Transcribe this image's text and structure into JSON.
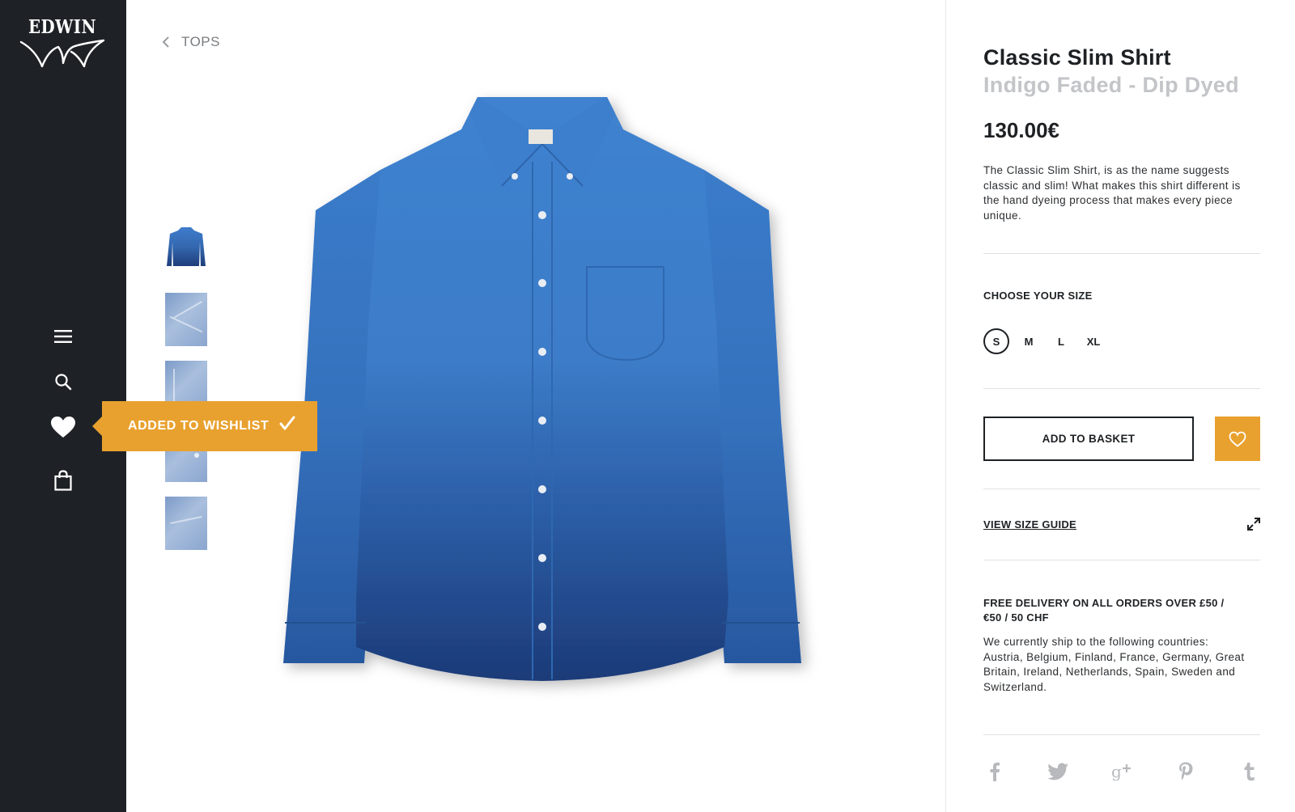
{
  "brand": {
    "name": "EDWIN"
  },
  "sidebar": {
    "icons": [
      "menu-icon",
      "search-icon",
      "heart-icon",
      "bag-icon"
    ]
  },
  "breadcrumb": {
    "label": "TOPS"
  },
  "toast": {
    "message": "ADDED TO WISHLIST"
  },
  "product": {
    "title": "Classic Slim Shirt",
    "subtitle": "Indigo Faded - Dip Dyed",
    "price": "130.00€",
    "description": "The Classic Slim Shirt, is as the name suggests classic and slim! What makes this shirt different is the hand dyeing process that makes every piece unique."
  },
  "size_selector": {
    "label": "CHOOSE YOUR SIZE",
    "options": [
      "S",
      "M",
      "L",
      "XL"
    ],
    "selected": "S"
  },
  "actions": {
    "add_to_basket": "ADD TO BASKET",
    "size_guide": "VIEW SIZE GUIDE"
  },
  "delivery": {
    "title": "FREE DELIVERY ON ALL ORDERS OVER £50 / €50 / 50 CHF",
    "text": "We currently ship to the following countries: Austria, Belgium, Finland, France, Germany, Great Britain, Ireland, Netherlands, Spain, Sweden and Switzerland."
  },
  "social": [
    "facebook-icon",
    "twitter-icon",
    "google-plus-icon",
    "pinterest-icon",
    "tumblr-icon"
  ],
  "colors": {
    "sidebar": "#1e2226",
    "accent": "#e8a12f",
    "text": "#1e2124",
    "muted": "#c3c5c8"
  }
}
